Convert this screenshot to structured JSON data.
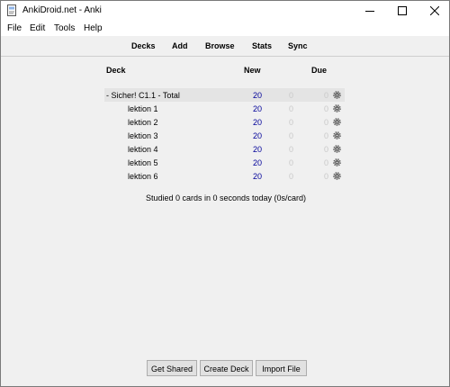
{
  "window": {
    "title": "AnkiDroid.net - Anki"
  },
  "menu": {
    "file": "File",
    "edit": "Edit",
    "tools": "Tools",
    "help": "Help"
  },
  "toolbar": {
    "decks": "Decks",
    "add": "Add",
    "browse": "Browse",
    "stats": "Stats",
    "sync": "Sync"
  },
  "deck_list": {
    "headers": {
      "deck": "Deck",
      "new": "New",
      "due": "Due"
    },
    "decks": [
      {
        "name": "- Sicher! C1.1 - Total",
        "new": "20",
        "learn": "0",
        "due": "0"
      },
      {
        "name": "lektion 1",
        "new": "20",
        "learn": "0",
        "due": "0"
      },
      {
        "name": "lektion 2",
        "new": "20",
        "learn": "0",
        "due": "0"
      },
      {
        "name": "lektion 3",
        "new": "20",
        "learn": "0",
        "due": "0"
      },
      {
        "name": "lektion 4",
        "new": "20",
        "learn": "0",
        "due": "0"
      },
      {
        "name": "lektion 5",
        "new": "20",
        "learn": "0",
        "due": "0"
      },
      {
        "name": "lektion 6",
        "new": "20",
        "learn": "0",
        "due": "0"
      }
    ]
  },
  "studied_text": "Studied 0 cards in 0 seconds today (0s/card)",
  "buttons": {
    "get_shared": "Get Shared",
    "create_deck": "Create Deck",
    "import_file": "Import File"
  },
  "colors": {
    "new_count": "#000099",
    "zero_count": "#c9c9c9",
    "selected_row": "#e4e4e4"
  }
}
